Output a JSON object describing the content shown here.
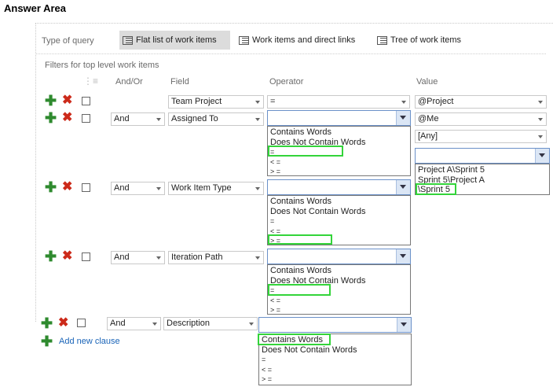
{
  "title": "Answer Area",
  "query_type": {
    "label": "Type of query",
    "options": [
      "Flat list of work items",
      "Work items and direct links",
      "Tree of work items"
    ],
    "selected": "Flat list of work items"
  },
  "filters_label": "Filters for top level work items",
  "columns": {
    "andor": "And/Or",
    "field": "Field",
    "operator": "Operator",
    "value": "Value"
  },
  "operator_options": [
    "Contains Words",
    "Does Not Contain Words",
    "=",
    "< =",
    "> ="
  ],
  "rows": [
    {
      "andor": "",
      "field": "Team Project",
      "operator": "=",
      "value": "@Project"
    },
    {
      "andor": "And",
      "field": "Assigned To",
      "operator": "",
      "value": "@Me",
      "selected_option": "="
    },
    {
      "andor": "And",
      "field": "Work Item Type",
      "operator": "",
      "selected_option": "> ="
    },
    {
      "andor": "And",
      "field": "Iteration Path",
      "operator": "",
      "selected_option": "="
    },
    {
      "andor": "And",
      "field": "Description",
      "operator": "",
      "selected_option": "Contains Words"
    }
  ],
  "value_dropdown": {
    "current": "[Any]",
    "options": [
      "Project A\\Sprint 5",
      "Sprint 5\\Project A",
      "\\Sprint 5"
    ],
    "selected_option": "\\Sprint 5"
  },
  "add_clause": "Add new clause",
  "colors": {
    "highlight": "#33d43a",
    "add": "#2e8a2e",
    "remove": "#cc2a1a",
    "link": "#1a64b8"
  }
}
